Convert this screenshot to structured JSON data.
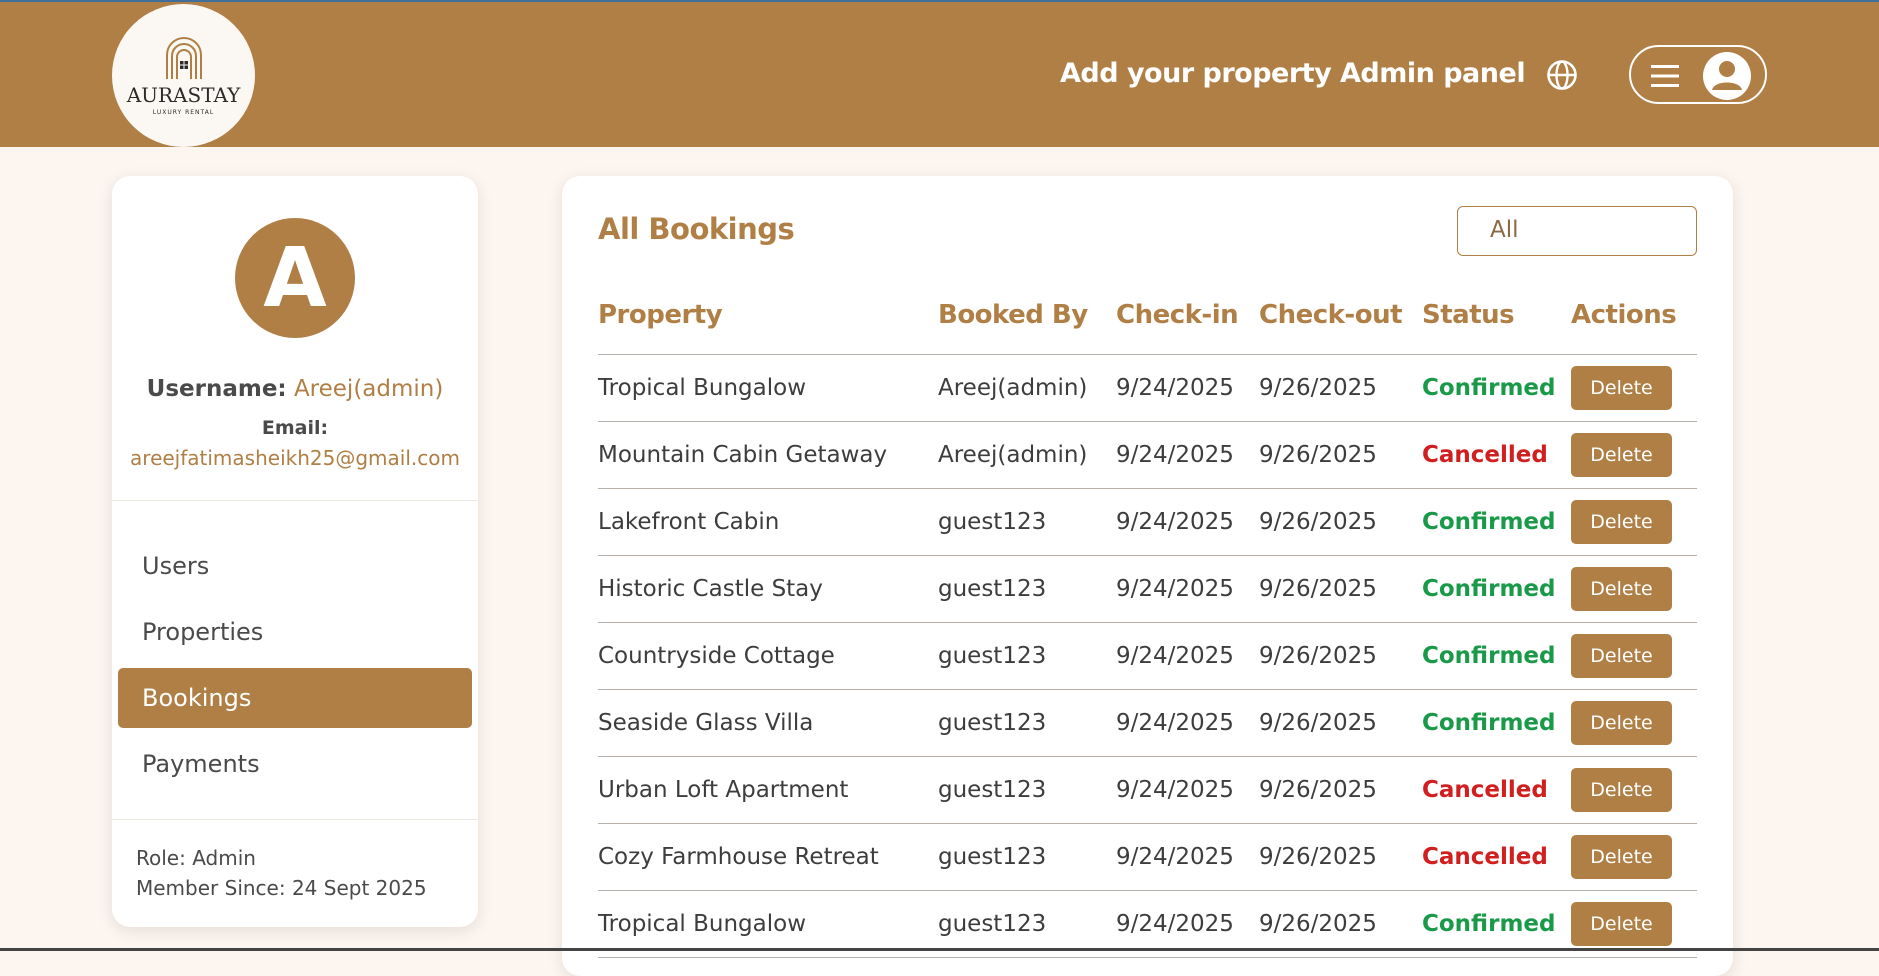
{
  "header": {
    "logo": {
      "brand": "AURASTAY",
      "tagline": "LUXURY RENTAL"
    },
    "nav": {
      "add_property": "Add your property",
      "admin_panel": "Admin panel"
    }
  },
  "sidebar": {
    "avatar_letter": "A",
    "username_label": "Username:",
    "username_value": "Areej(admin)",
    "email_label": "Email:",
    "email_value": "areejfatimasheikh25@gmail.com",
    "menu": [
      "Users",
      "Properties",
      "Bookings",
      "Payments"
    ],
    "active_menu": "Bookings",
    "role": "Role: Admin",
    "member_since": "Member Since: 24 Sept 2025"
  },
  "main": {
    "title": "All Bookings",
    "filter": {
      "selected": "All"
    },
    "columns": [
      "Property",
      "Booked By",
      "Check-in",
      "Check-out",
      "Status",
      "Actions"
    ],
    "action_label": "Delete",
    "rows": [
      {
        "property": "Tropical Bungalow",
        "booked_by": "Areej(admin)",
        "check_in": "9/24/2025",
        "check_out": "9/26/2025",
        "status": "Confirmed"
      },
      {
        "property": "Mountain Cabin Getaway",
        "booked_by": "Areej(admin)",
        "check_in": "9/24/2025",
        "check_out": "9/26/2025",
        "status": "Cancelled"
      },
      {
        "property": "Lakefront Cabin",
        "booked_by": "guest123",
        "check_in": "9/24/2025",
        "check_out": "9/26/2025",
        "status": "Confirmed"
      },
      {
        "property": "Historic Castle Stay",
        "booked_by": "guest123",
        "check_in": "9/24/2025",
        "check_out": "9/26/2025",
        "status": "Confirmed"
      },
      {
        "property": "Countryside Cottage",
        "booked_by": "guest123",
        "check_in": "9/24/2025",
        "check_out": "9/26/2025",
        "status": "Confirmed"
      },
      {
        "property": "Seaside Glass Villa",
        "booked_by": "guest123",
        "check_in": "9/24/2025",
        "check_out": "9/26/2025",
        "status": "Confirmed"
      },
      {
        "property": "Urban Loft Apartment",
        "booked_by": "guest123",
        "check_in": "9/24/2025",
        "check_out": "9/26/2025",
        "status": "Cancelled"
      },
      {
        "property": "Cozy Farmhouse Retreat",
        "booked_by": "guest123",
        "check_in": "9/24/2025",
        "check_out": "9/26/2025",
        "status": "Cancelled"
      },
      {
        "property": "Tropical Bungalow",
        "booked_by": "guest123",
        "check_in": "9/24/2025",
        "check_out": "9/26/2025",
        "status": "Confirmed"
      }
    ]
  },
  "colors": {
    "brand": "#b07f45",
    "background": "#fdf5ef",
    "confirmed": "#1a9a49",
    "cancelled": "#d11f1f"
  },
  "icons": [
    "globe-icon",
    "hamburger-icon",
    "user-avatar-icon"
  ]
}
